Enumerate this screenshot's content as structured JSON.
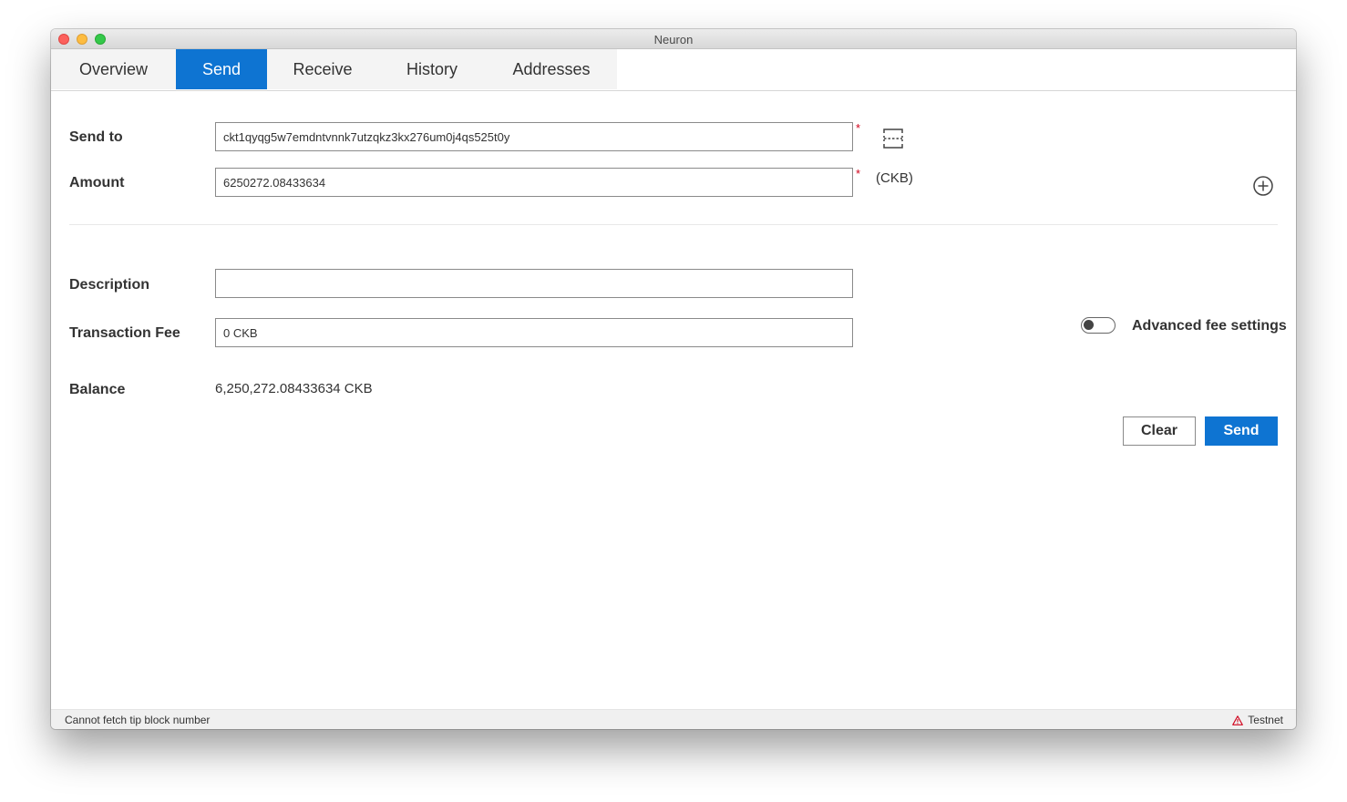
{
  "window": {
    "title": "Neuron"
  },
  "tabs": [
    {
      "label": "Overview",
      "active": false
    },
    {
      "label": "Send",
      "active": true
    },
    {
      "label": "Receive",
      "active": false
    },
    {
      "label": "History",
      "active": false
    },
    {
      "label": "Addresses",
      "active": false
    }
  ],
  "form": {
    "send_to": {
      "label": "Send to",
      "value": "ckt1qyqg5w7emdntvnnk7utzqkz3kx276um0j4qs525t0y",
      "required_mark": "*"
    },
    "amount": {
      "label": "Amount",
      "value": "6250272.08433634",
      "required_mark": "*",
      "unit": "(CKB)"
    },
    "description": {
      "label": "Description",
      "value": ""
    },
    "transaction_fee": {
      "label": "Transaction Fee",
      "value": "0 CKB"
    },
    "balance": {
      "label": "Balance",
      "value": "6,250,272.08433634 CKB"
    },
    "advanced_fee": {
      "label": "Advanced fee settings",
      "enabled": false
    }
  },
  "actions": {
    "clear_label": "Clear",
    "send_label": "Send"
  },
  "icons": {
    "scan": "scan-qr-icon",
    "add": "add-circle-icon",
    "warning": "warning-icon"
  },
  "statusbar": {
    "message": "Cannot fetch tip block number",
    "network": "Testnet"
  },
  "colors": {
    "accent": "#0e74d2",
    "required": "#d0021b",
    "warning": "#d0021b"
  }
}
